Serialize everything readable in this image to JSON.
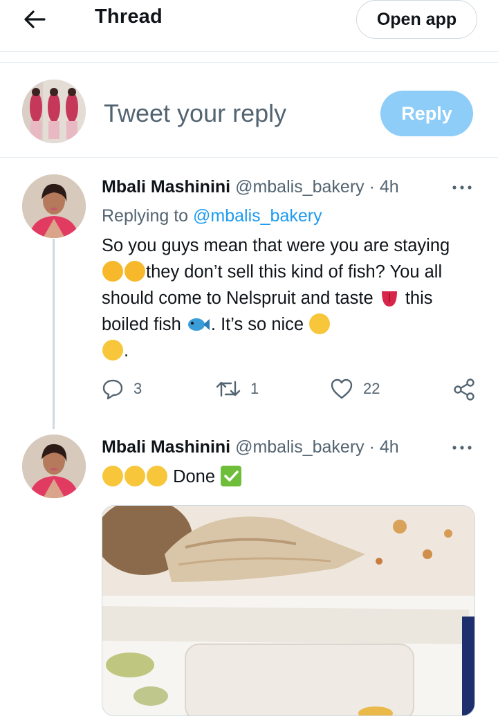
{
  "header": {
    "title": "Thread",
    "open_app_label": "Open app"
  },
  "compose": {
    "placeholder": "Tweet your reply",
    "reply_label": "Reply"
  },
  "tweets": [
    {
      "display_name": "Mbali Mashinini",
      "handle": "@mbalis_bakery",
      "separator": "·",
      "time": "4h",
      "replying_prefix": "Replying to",
      "replying_to": "@mbalis_bakery",
      "text_parts": {
        "p1": "So you guys mean that were you are staying ",
        "p2": "they don’t sell this kind of fish? You all should come to Nelspruit and taste ",
        "p3": " this boiled fish ",
        "p4": ". It’s so nice ",
        "p5": "."
      },
      "counts": {
        "replies": "3",
        "retweets": "1",
        "likes": "22"
      }
    },
    {
      "display_name": "Mbali Mashinini",
      "handle": "@mbalis_bakery",
      "separator": "·",
      "time": "4h",
      "text_parts": {
        "p1": " Done "
      }
    }
  ],
  "icons": {
    "back": "arrow-left-icon",
    "more": "more-horizontal-icon",
    "reply": "reply-bubble-icon",
    "retweet": "retweet-icon",
    "like": "heart-icon",
    "share": "share-icon"
  },
  "colors": {
    "accent": "#1d9bf0",
    "reply_button": "#8ecdf7",
    "secondary_text": "#536471",
    "thread_line": "#cfd9de"
  }
}
